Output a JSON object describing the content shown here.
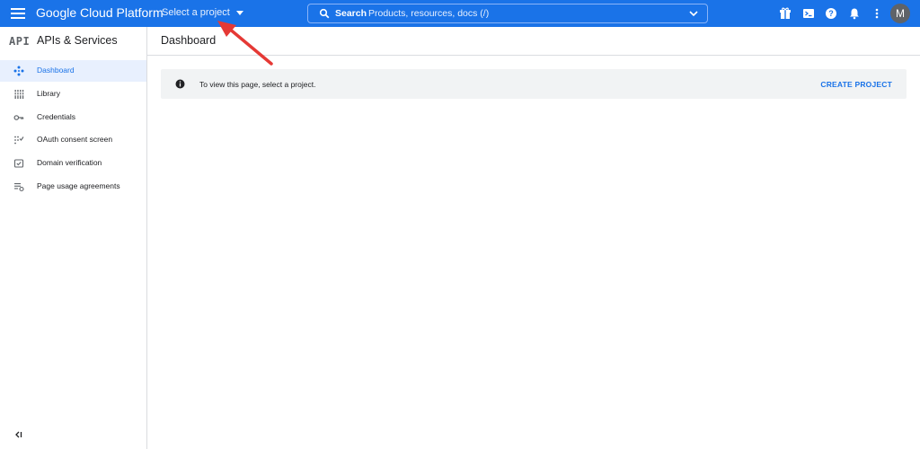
{
  "topbar": {
    "brand": "Google Cloud Platform",
    "project_selector": "Select a project",
    "search": {
      "label": "Search",
      "placeholder": "Products, resources, docs (/)"
    },
    "icons": [
      "gift-icon",
      "cloud-shell-icon",
      "help-icon",
      "notifications-icon",
      "more-vert-icon"
    ],
    "avatar_initial": "M",
    "color": "#1a73e8"
  },
  "sidebar": {
    "logo": "API",
    "title": "APIs & Services",
    "items": [
      {
        "label": "Dashboard",
        "icon": "dashboard-icon",
        "active": true
      },
      {
        "label": "Library",
        "icon": "library-icon",
        "active": false
      },
      {
        "label": "Credentials",
        "icon": "key-icon",
        "active": false
      },
      {
        "label": "OAuth consent screen",
        "icon": "consent-icon",
        "active": false
      },
      {
        "label": "Domain verification",
        "icon": "domain-check-icon",
        "active": false
      },
      {
        "label": "Page usage agreements",
        "icon": "agreements-icon",
        "active": false
      }
    ]
  },
  "main": {
    "title": "Dashboard",
    "banner": {
      "message": "To view this page, select a project.",
      "action": "CREATE PROJECT"
    }
  },
  "annotation": {
    "arrow_color": "#e53935"
  }
}
